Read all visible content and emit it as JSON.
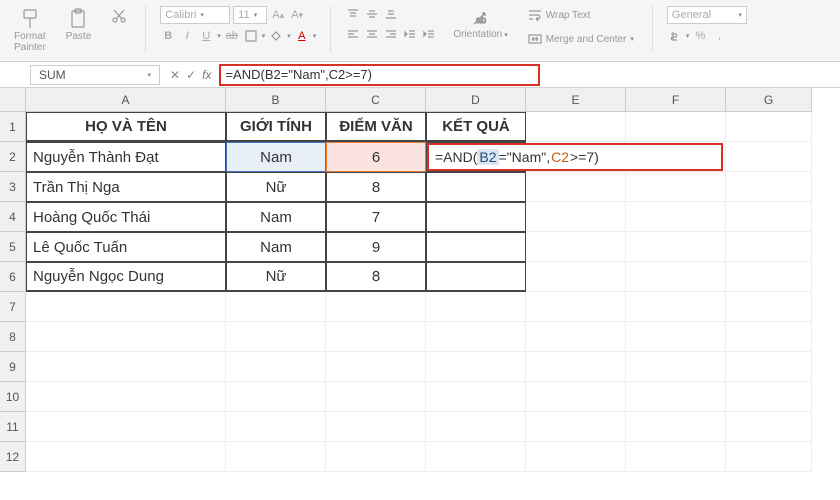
{
  "ribbon": {
    "format_painter": "Format\nPainter",
    "paste": "Paste",
    "font_name": "Calibri",
    "font_size": "11",
    "wrap_text": "Wrap Text",
    "merge_center": "Merge and Center",
    "orientation": "Orientation",
    "number_format": "General"
  },
  "formula_bar": {
    "name_box": "SUM",
    "formula": "=AND(B2=\"Nam\",C2>=7)"
  },
  "columns": [
    "A",
    "B",
    "C",
    "D",
    "E",
    "F",
    "G"
  ],
  "rows": [
    "1",
    "2",
    "3",
    "4",
    "5",
    "6",
    "7",
    "8",
    "9",
    "10",
    "11",
    "12"
  ],
  "headers": {
    "A": "HỌ VÀ TÊN",
    "B": "GIỚI TÍNH",
    "C": "ĐIỂM VĂN",
    "D": "KẾT QUẢ"
  },
  "table": [
    {
      "name": "Nguyễn Thành Đạt",
      "gender": "Nam",
      "score": "6"
    },
    {
      "name": "Trần Thị Nga",
      "gender": "Nữ",
      "score": "8"
    },
    {
      "name": "Hoàng Quốc Thái",
      "gender": "Nam",
      "score": "7"
    },
    {
      "name": "Lê Quốc Tuấn",
      "gender": "Nam",
      "score": "9"
    },
    {
      "name": "Nguyễn Ngọc Dung",
      "gender": "Nữ",
      "score": "8"
    }
  ],
  "editing_cell": {
    "prefix": "=AND(",
    "ref1": " B2 ",
    "mid1": "=\"Nam\",",
    "ref2": " C2 ",
    "suffix": ">=7)"
  },
  "chart_data": {
    "type": "table",
    "title": "",
    "columns": [
      "HỌ VÀ TÊN",
      "GIỚI TÍNH",
      "ĐIỂM VĂN",
      "KẾT QUẢ"
    ],
    "rows": [
      [
        "Nguyễn Thành Đạt",
        "Nam",
        6,
        "=AND(B2=\"Nam\",C2>=7)"
      ],
      [
        "Trần Thị Nga",
        "Nữ",
        8,
        ""
      ],
      [
        "Hoàng Quốc Thái",
        "Nam",
        7,
        ""
      ],
      [
        "Lê Quốc Tuấn",
        "Nam",
        9,
        ""
      ],
      [
        "Nguyễn Ngọc Dung",
        "Nữ",
        8,
        ""
      ]
    ]
  }
}
